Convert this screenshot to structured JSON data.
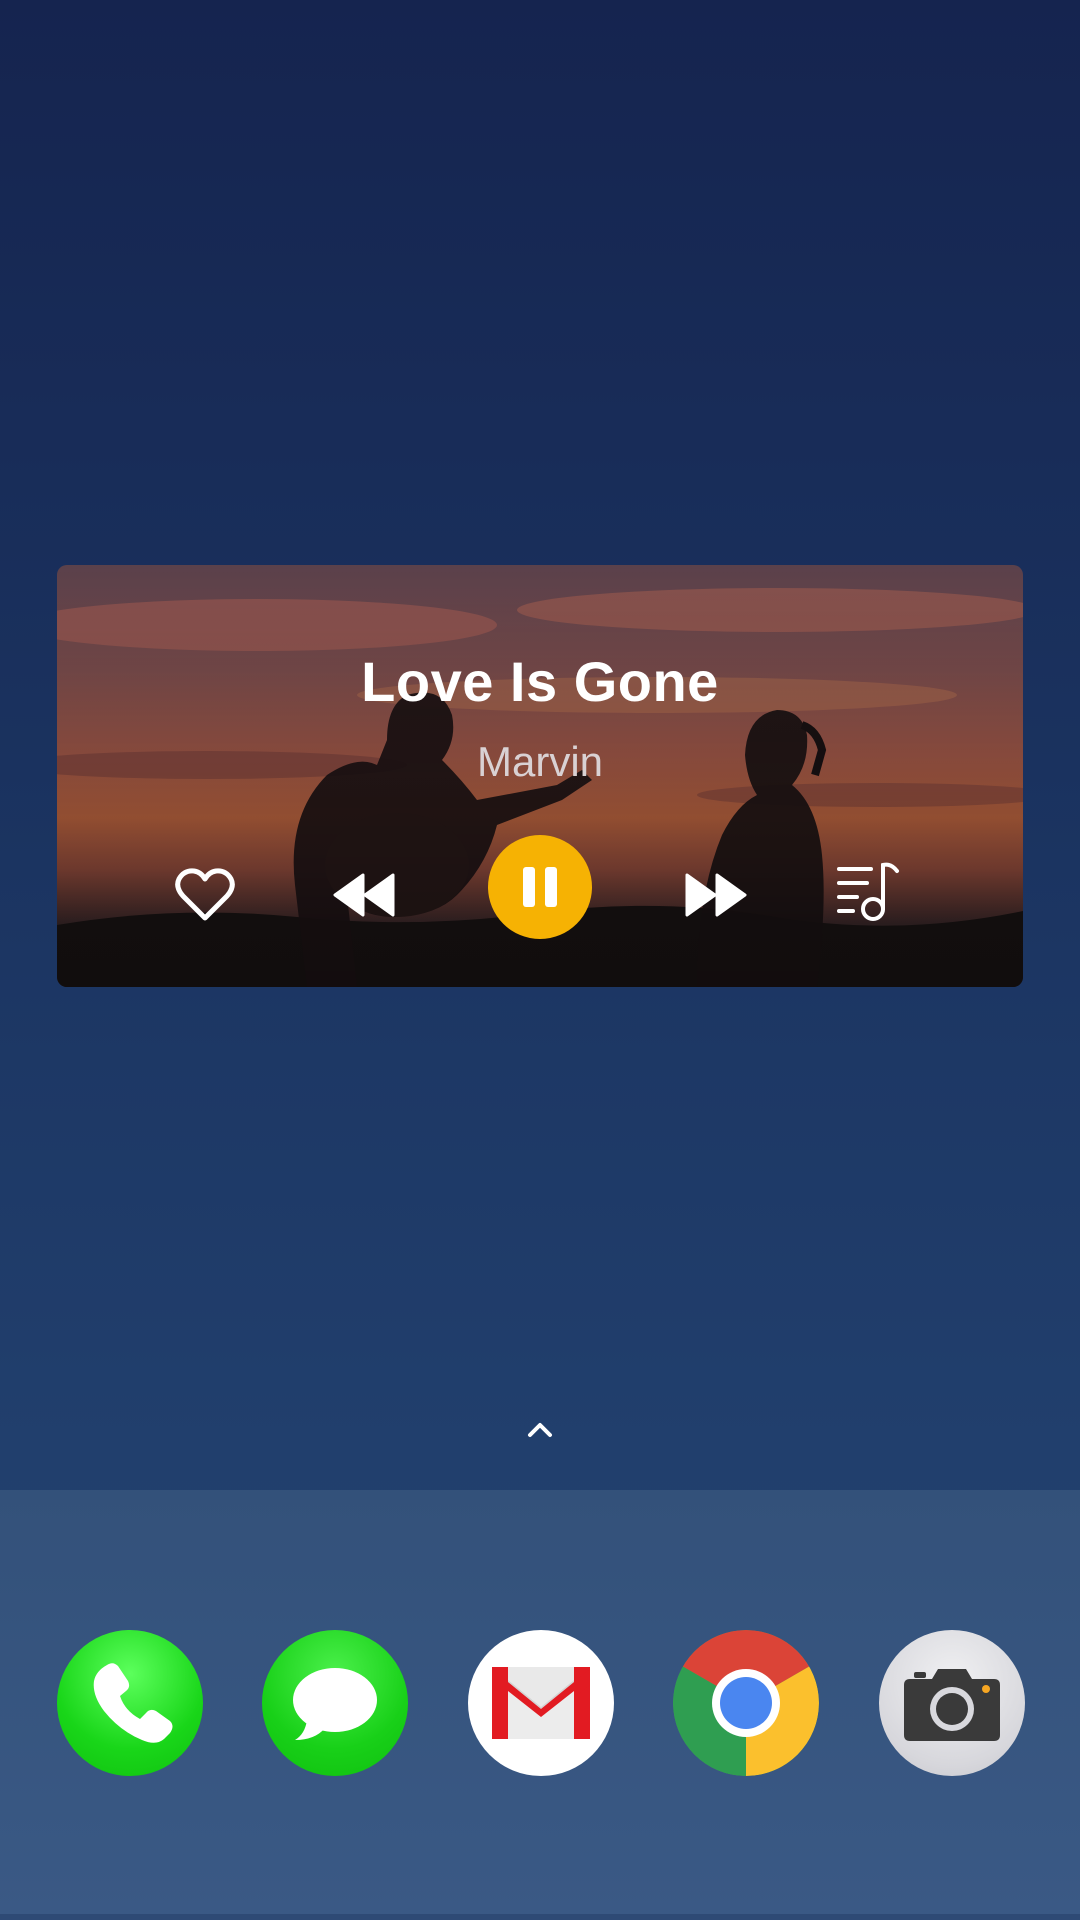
{
  "music_widget": {
    "title": "Love Is Gone",
    "artist": "Marvin",
    "state": "playing",
    "accent_color": "#f6b203",
    "controls": [
      "heart-icon",
      "rewind-icon",
      "pause-icon",
      "fast-forward-icon",
      "playlist-music-icon"
    ]
  },
  "home": {
    "swipe_icon": "chevron-up-icon"
  },
  "dock": {
    "apps": [
      {
        "name": "Phone",
        "icon": "phone-icon",
        "color": "#19d619"
      },
      {
        "name": "Messages",
        "icon": "message-bubble-icon",
        "color": "#18d018"
      },
      {
        "name": "Gmail",
        "icon": "gmail-icon",
        "color": "#ea1c24"
      },
      {
        "name": "Chrome",
        "icon": "chrome-icon",
        "color": "#4285f4"
      },
      {
        "name": "Camera",
        "icon": "camera-icon",
        "color": "#3a3a3a"
      }
    ]
  }
}
